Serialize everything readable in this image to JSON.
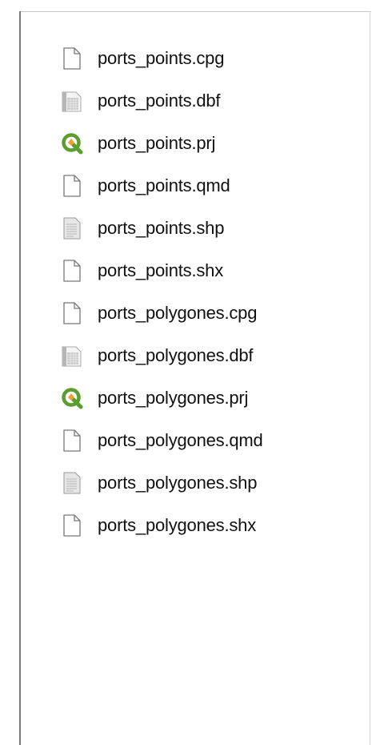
{
  "files": [
    {
      "name": "ports_points.cpg",
      "icon": "generic-file-icon"
    },
    {
      "name": "ports_points.dbf",
      "icon": "table-file-icon"
    },
    {
      "name": "ports_points.prj",
      "icon": "qgis-icon"
    },
    {
      "name": "ports_points.qmd",
      "icon": "generic-file-icon"
    },
    {
      "name": "ports_points.shp",
      "icon": "text-file-icon"
    },
    {
      "name": "ports_points.shx",
      "icon": "generic-file-icon"
    },
    {
      "name": "ports_polygones.cpg",
      "icon": "generic-file-icon"
    },
    {
      "name": "ports_polygones.dbf",
      "icon": "table-file-icon"
    },
    {
      "name": "ports_polygones.prj",
      "icon": "qgis-icon"
    },
    {
      "name": "ports_polygones.qmd",
      "icon": "generic-file-icon"
    },
    {
      "name": "ports_polygones.shp",
      "icon": "text-file-icon"
    },
    {
      "name": "ports_polygones.shx",
      "icon": "generic-file-icon"
    }
  ],
  "colors": {
    "qgis_green": "#5a9e2f",
    "qgis_orange": "#f0a030",
    "text": "#111111"
  }
}
